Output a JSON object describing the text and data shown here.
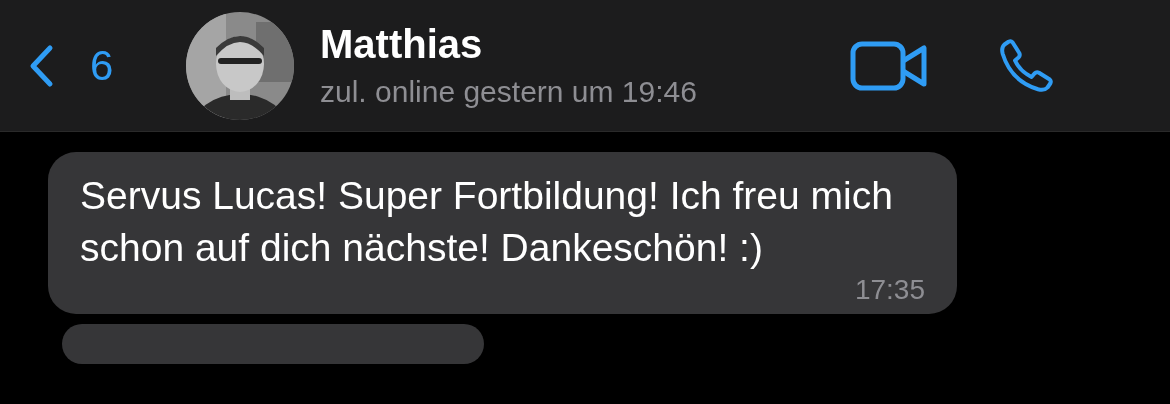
{
  "header": {
    "back_count": "6",
    "name": "Matthias",
    "status": "zul. online gestern um 19:46"
  },
  "messages": [
    {
      "text": "Servus Lucas! Super Fortbildung! Ich freu mich schon auf dich nächste! Dankeschön! :)",
      "time": "17:35"
    }
  ]
}
